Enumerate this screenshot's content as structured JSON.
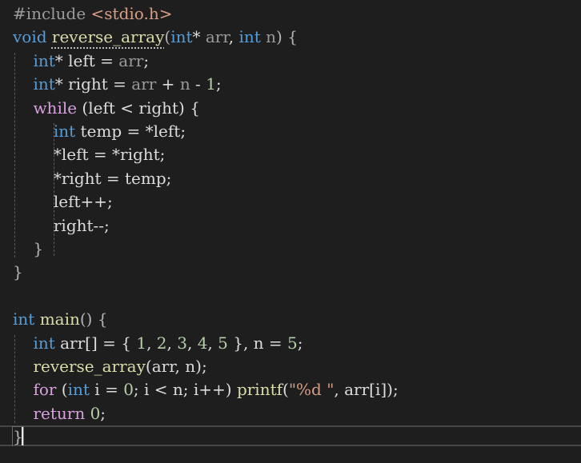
{
  "editor": {
    "language": "C",
    "theme": "dark",
    "caret_line": 19,
    "colors": {
      "background": "#1e1e1e",
      "default_text": "#dcdcdc",
      "keyword": "#569cd6",
      "control_keyword": "#d8a0df",
      "function": "#dcdcaa",
      "parameter": "#9a9a9a",
      "number": "#b5cea8",
      "string": "#d69d85",
      "preprocessor": "#9b9b9b",
      "current_line_border": "#464646"
    },
    "lines": [
      {
        "tokens": [
          {
            "t": "#include ",
            "c": "pp"
          },
          {
            "t": "<stdio.h>",
            "c": "inc"
          }
        ]
      },
      {
        "tokens": [
          {
            "t": "void",
            "c": "kw"
          },
          {
            "t": " ",
            "c": "var"
          },
          {
            "t": "reverse_array",
            "c": "fn",
            "squiggle": true
          },
          {
            "t": "(",
            "c": "punc"
          },
          {
            "t": "int",
            "c": "kw"
          },
          {
            "t": "* ",
            "c": "var"
          },
          {
            "t": "arr",
            "c": "param"
          },
          {
            "t": ", ",
            "c": "var"
          },
          {
            "t": "int",
            "c": "kw"
          },
          {
            "t": " ",
            "c": "var"
          },
          {
            "t": "n",
            "c": "param"
          },
          {
            "t": ") {",
            "c": "punc"
          }
        ]
      },
      {
        "tokens": [
          {
            "t": "    ",
            "c": "var"
          },
          {
            "t": "int",
            "c": "kw"
          },
          {
            "t": "* left = ",
            "c": "var"
          },
          {
            "t": "arr",
            "c": "param"
          },
          {
            "t": ";",
            "c": "var"
          }
        ]
      },
      {
        "tokens": [
          {
            "t": "    ",
            "c": "var"
          },
          {
            "t": "int",
            "c": "kw"
          },
          {
            "t": "* right = ",
            "c": "var"
          },
          {
            "t": "arr",
            "c": "param"
          },
          {
            "t": " + ",
            "c": "var"
          },
          {
            "t": "n",
            "c": "param"
          },
          {
            "t": " - ",
            "c": "var"
          },
          {
            "t": "1",
            "c": "num"
          },
          {
            "t": ";",
            "c": "var"
          }
        ]
      },
      {
        "tokens": [
          {
            "t": "    ",
            "c": "var"
          },
          {
            "t": "while",
            "c": "ctrl"
          },
          {
            "t": " (left < right) {",
            "c": "var"
          }
        ]
      },
      {
        "tokens": [
          {
            "t": "        ",
            "c": "var"
          },
          {
            "t": "int",
            "c": "kw"
          },
          {
            "t": " temp = *left;",
            "c": "var"
          }
        ]
      },
      {
        "tokens": [
          {
            "t": "        *left = *right;",
            "c": "var"
          }
        ]
      },
      {
        "tokens": [
          {
            "t": "        *right = temp;",
            "c": "var"
          }
        ]
      },
      {
        "tokens": [
          {
            "t": "        left++;",
            "c": "var"
          }
        ]
      },
      {
        "tokens": [
          {
            "t": "        right--;",
            "c": "var"
          }
        ]
      },
      {
        "tokens": [
          {
            "t": "    }",
            "c": "punc"
          }
        ]
      },
      {
        "tokens": [
          {
            "t": "}",
            "c": "punc"
          }
        ]
      },
      {
        "tokens": []
      },
      {
        "tokens": [
          {
            "t": "int",
            "c": "kw"
          },
          {
            "t": " ",
            "c": "var"
          },
          {
            "t": "main",
            "c": "fn"
          },
          {
            "t": "() {",
            "c": "punc"
          }
        ]
      },
      {
        "tokens": [
          {
            "t": "    ",
            "c": "var"
          },
          {
            "t": "int",
            "c": "kw"
          },
          {
            "t": " arr[] = { ",
            "c": "var"
          },
          {
            "t": "1",
            "c": "num"
          },
          {
            "t": ", ",
            "c": "var"
          },
          {
            "t": "2",
            "c": "num"
          },
          {
            "t": ", ",
            "c": "var"
          },
          {
            "t": "3",
            "c": "num"
          },
          {
            "t": ", ",
            "c": "var"
          },
          {
            "t": "4",
            "c": "num"
          },
          {
            "t": ", ",
            "c": "var"
          },
          {
            "t": "5",
            "c": "num"
          },
          {
            "t": " }, n = ",
            "c": "var"
          },
          {
            "t": "5",
            "c": "num"
          },
          {
            "t": ";",
            "c": "var"
          }
        ]
      },
      {
        "tokens": [
          {
            "t": "    ",
            "c": "var"
          },
          {
            "t": "reverse_array",
            "c": "fn"
          },
          {
            "t": "(arr, n);",
            "c": "var"
          }
        ]
      },
      {
        "tokens": [
          {
            "t": "    ",
            "c": "var"
          },
          {
            "t": "for",
            "c": "ctrl"
          },
          {
            "t": " (",
            "c": "var"
          },
          {
            "t": "int",
            "c": "kw"
          },
          {
            "t": " i = ",
            "c": "var"
          },
          {
            "t": "0",
            "c": "num"
          },
          {
            "t": "; i < n; i++) ",
            "c": "var"
          },
          {
            "t": "printf",
            "c": "fn"
          },
          {
            "t": "(",
            "c": "var"
          },
          {
            "t": "\"%d \"",
            "c": "str"
          },
          {
            "t": ", arr[i]);",
            "c": "var"
          }
        ]
      },
      {
        "tokens": [
          {
            "t": "    ",
            "c": "var"
          },
          {
            "t": "return",
            "c": "ctrl"
          },
          {
            "t": " ",
            "c": "var"
          },
          {
            "t": "0",
            "c": "num"
          },
          {
            "t": ";",
            "c": "var"
          }
        ]
      },
      {
        "tokens": [
          {
            "t": "}",
            "c": "punc",
            "match": true
          }
        ]
      }
    ]
  }
}
